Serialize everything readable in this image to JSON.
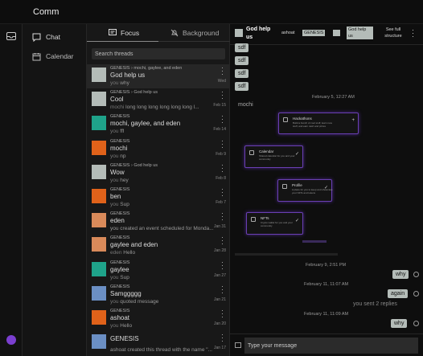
{
  "app": {
    "title": "Comm"
  },
  "nav": {
    "chat": "Chat",
    "calendar": "Calendar"
  },
  "threads_panel": {
    "tabs": [
      "Focus",
      "Background"
    ],
    "search_placeholder": "Search threads",
    "items": [
      {
        "crumb": "GENESIS  ›  mochi, gaylee, and eden",
        "name": "God help us",
        "who": "you",
        "last": "why",
        "date": "Wed",
        "color": "#b4bcb8",
        "selected": true
      },
      {
        "crumb": "GENESIS  ›  God help us",
        "name": "Cool",
        "who": "mochi",
        "last": "long long long long long long l...",
        "date": "Feb 15",
        "color": "#b4bcb8"
      },
      {
        "crumb": "GENESIS",
        "name": "mochi, gaylee, and eden",
        "who": "you",
        "last": "fff",
        "date": "Feb 14",
        "color": "#1fa38a"
      },
      {
        "crumb": "GENESIS",
        "name": "mochi",
        "who": "you",
        "last": "np",
        "date": "Feb 9",
        "color": "#e0621a"
      },
      {
        "crumb": "GENESIS  ›  God help us",
        "name": "Wow",
        "who": "you",
        "last": "hey",
        "date": "Feb 8",
        "color": "#b4bcb8"
      },
      {
        "crumb": "GENESIS",
        "name": "ben",
        "who": "you",
        "last": "Sup",
        "date": "Feb 7",
        "color": "#e0621a"
      },
      {
        "crumb": "GENESIS",
        "name": "eden",
        "who": "",
        "last": "you created an event scheduled for Monda...",
        "date": "Jan 31",
        "color": "#d98a5a"
      },
      {
        "crumb": "GENESIS",
        "name": "gaylee and eden",
        "who": "eden",
        "last": "Hello",
        "date": "Jan 28",
        "color": "#d98a5a"
      },
      {
        "crumb": "GENESIS",
        "name": "gaylee",
        "who": "you",
        "last": "Sup",
        "date": "Jan 27",
        "color": "#1fa38a"
      },
      {
        "crumb": "GENESIS",
        "name": "Samggggg",
        "who": "you",
        "last": "quoted message",
        "date": "Jan 21",
        "color": "#6b8fc4"
      },
      {
        "crumb": "GENESIS",
        "name": "ashoat",
        "who": "you",
        "last": "Hello",
        "date": "Jan 20",
        "color": "#e0621a"
      },
      {
        "crumb": "",
        "name": "GENESIS",
        "who": "",
        "last": "ashoat created this thread with the name \"...",
        "date": "Jan 17",
        "color": "#6b8fc4"
      }
    ]
  },
  "chat": {
    "title": "God help us",
    "breadcrumb": [
      "ashoat",
      "GENESIS",
      "God help us"
    ],
    "see_full": "See full structure",
    "sdf_bubbles": [
      "sdf",
      "sdf",
      "sdf",
      "sdf"
    ],
    "ts1": "February 5, 12:27 AM",
    "sender": "mochi",
    "cards": [
      {
        "title": "Hackathons",
        "desc": "Build a bunch of cool stuff, learn new stuff, and earn cash and prizes",
        "icon": "target-icon",
        "action": "+"
      },
      {
        "title": "Calendar",
        "desc": "Shared calendar for you and your community",
        "icon": "calendar-icon",
        "action": "✓"
      },
      {
        "title": "Profile",
        "desc": "A place for you to keep and showcase your NFTs and tokens",
        "icon": "profile-icon",
        "action": "✓"
      },
      {
        "title": "NFTs",
        "desc": "Crypto wallet for you and your community",
        "icon": "grid-icon",
        "action": "✓"
      }
    ],
    "ts2": "February 9, 2:51 PM",
    "why1": "why",
    "ts3": "February 11, 11:07 AM",
    "again": "again",
    "replies": "you sent 2 replies",
    "ts4": "February 11, 11:09 AM",
    "why2": "why",
    "composer_placeholder": "Type your message"
  }
}
